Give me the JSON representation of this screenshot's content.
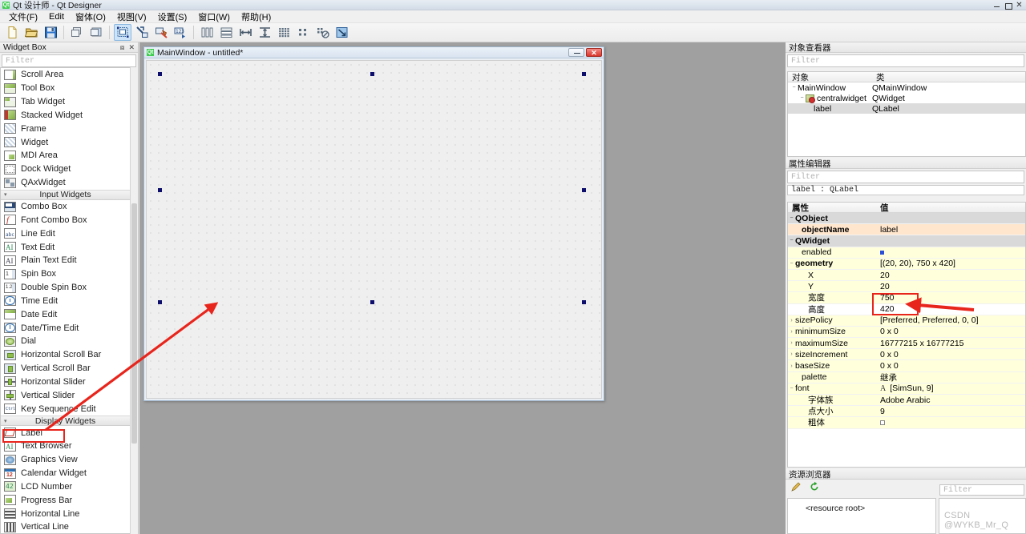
{
  "window": {
    "title": "Qt 设计师 - Qt Designer",
    "logo": "qt-logo",
    "buttons": {
      "minimize": "minimize-icon",
      "maximize": "maximize-icon",
      "close": "close-icon"
    }
  },
  "menubar": {
    "items": [
      {
        "label": "文件(F)"
      },
      {
        "label": "Edit"
      },
      {
        "label": "窗体(O)"
      },
      {
        "label": "视图(V)"
      },
      {
        "label": "设置(S)"
      },
      {
        "label": "窗口(W)"
      },
      {
        "label": "帮助(H)"
      }
    ]
  },
  "toolbar": {
    "items": [
      {
        "name": "new-form-icon",
        "active": false
      },
      {
        "name": "open-icon",
        "active": false
      },
      {
        "name": "save-icon",
        "active": false
      },
      {
        "name": "separator",
        "active": false
      },
      {
        "name": "undo-icon",
        "active": false
      },
      {
        "name": "redo-icon",
        "active": false
      },
      {
        "name": "separator",
        "active": false
      },
      {
        "name": "edit-widgets-icon",
        "active": true
      },
      {
        "name": "edit-signals-slots-icon",
        "active": false
      },
      {
        "name": "edit-buddies-icon",
        "active": false
      },
      {
        "name": "edit-tab-order-icon",
        "active": false
      },
      {
        "name": "separator",
        "active": false
      },
      {
        "name": "layout-horizontally-icon",
        "active": false
      },
      {
        "name": "layout-vertically-icon",
        "active": false
      },
      {
        "name": "layout-splitter-horizontal-icon",
        "active": false
      },
      {
        "name": "layout-splitter-vertical-icon",
        "active": false
      },
      {
        "name": "layout-grid-icon",
        "active": false
      },
      {
        "name": "layout-form-icon",
        "active": false
      },
      {
        "name": "break-layout-icon",
        "active": false
      },
      {
        "name": "adjust-size-icon",
        "active": false
      }
    ]
  },
  "widget_box": {
    "title": "Widget Box",
    "float_icon": "undock-icon",
    "close_icon": "close-icon",
    "filter_placeholder": "Filter",
    "items": [
      {
        "label": "Scroll Area",
        "icon": "scroll-area-icon",
        "type": "item"
      },
      {
        "label": "Tool Box",
        "icon": "tool-box-icon",
        "type": "item"
      },
      {
        "label": "Tab Widget",
        "icon": "tab-widget-icon",
        "type": "item"
      },
      {
        "label": "Stacked Widget",
        "icon": "stacked-widget-icon",
        "type": "item"
      },
      {
        "label": "Frame",
        "icon": "frame-icon",
        "type": "item"
      },
      {
        "label": "Widget",
        "icon": "widget-icon",
        "type": "item"
      },
      {
        "label": "MDI Area",
        "icon": "mdi-area-icon",
        "type": "item"
      },
      {
        "label": "Dock Widget",
        "icon": "dock-widget-icon",
        "type": "item"
      },
      {
        "label": "QAxWidget",
        "icon": "qax-widget-icon",
        "type": "item"
      },
      {
        "label": "Input Widgets",
        "icon": "",
        "type": "category"
      },
      {
        "label": "Combo Box",
        "icon": "combo-box-icon",
        "type": "item"
      },
      {
        "label": "Font Combo Box",
        "icon": "font-combo-box-icon",
        "type": "item"
      },
      {
        "label": "Line Edit",
        "icon": "line-edit-icon",
        "type": "item"
      },
      {
        "label": "Text Edit",
        "icon": "text-edit-icon",
        "type": "item"
      },
      {
        "label": "Plain Text Edit",
        "icon": "plain-text-edit-icon",
        "type": "item"
      },
      {
        "label": "Spin Box",
        "icon": "spin-box-icon",
        "type": "item"
      },
      {
        "label": "Double Spin Box",
        "icon": "double-spin-box-icon",
        "type": "item"
      },
      {
        "label": "Time Edit",
        "icon": "time-edit-icon",
        "type": "item"
      },
      {
        "label": "Date Edit",
        "icon": "date-edit-icon",
        "type": "item"
      },
      {
        "label": "Date/Time Edit",
        "icon": "date-time-edit-icon",
        "type": "item"
      },
      {
        "label": "Dial",
        "icon": "dial-icon",
        "type": "item"
      },
      {
        "label": "Horizontal Scroll Bar",
        "icon": "horizontal-scroll-bar-icon",
        "type": "item"
      },
      {
        "label": "Vertical Scroll Bar",
        "icon": "vertical-scroll-bar-icon",
        "type": "item"
      },
      {
        "label": "Horizontal Slider",
        "icon": "horizontal-slider-icon",
        "type": "item"
      },
      {
        "label": "Vertical Slider",
        "icon": "vertical-slider-icon",
        "type": "item"
      },
      {
        "label": "Key Sequence Edit",
        "icon": "key-sequence-edit-icon",
        "type": "item"
      },
      {
        "label": "Display Widgets",
        "icon": "",
        "type": "category"
      },
      {
        "label": "Label",
        "icon": "label-icon",
        "type": "item",
        "highlighted": true
      },
      {
        "label": "Text Browser",
        "icon": "text-browser-icon",
        "type": "item"
      },
      {
        "label": "Graphics View",
        "icon": "graphics-view-icon",
        "type": "item"
      },
      {
        "label": "Calendar Widget",
        "icon": "calendar-widget-icon",
        "type": "item"
      },
      {
        "label": "LCD Number",
        "icon": "lcd-number-icon",
        "type": "item"
      },
      {
        "label": "Progress Bar",
        "icon": "progress-bar-icon",
        "type": "item"
      },
      {
        "label": "Horizontal Line",
        "icon": "horizontal-line-icon",
        "type": "item"
      },
      {
        "label": "Vertical Line",
        "icon": "vertical-line-icon",
        "type": "item"
      }
    ]
  },
  "form": {
    "title": "MainWindow - untitled*",
    "logo": "qt-logo",
    "minimize_label": "minimize-icon",
    "close_label": "×",
    "selection_handles": 8
  },
  "object_inspector": {
    "title": "对象查看器",
    "filter_placeholder": "Filter",
    "columns": [
      "对象",
      "类"
    ],
    "rows": [
      {
        "object": "MainWindow",
        "class": "QMainWindow",
        "depth": 0,
        "expander": "−",
        "selected": false,
        "icon": ""
      },
      {
        "object": "centralwidget",
        "class": "QWidget",
        "depth": 1,
        "expander": "−",
        "selected": false,
        "icon": "central-widget-icon"
      },
      {
        "object": "label",
        "class": "QLabel",
        "depth": 2,
        "expander": "",
        "selected": true,
        "icon": ""
      }
    ]
  },
  "property_editor": {
    "title": "属性编辑器",
    "filter_placeholder": "Filter",
    "selected_object": "label : QLabel",
    "columns": [
      "属性",
      "值"
    ],
    "rows": [
      {
        "name": "QObject",
        "value": "",
        "style": "group",
        "indent": 0,
        "expander": "−"
      },
      {
        "name": "objectName",
        "value": "label",
        "style": "tan",
        "indent": 1,
        "expander": "",
        "bold": true
      },
      {
        "name": "QWidget",
        "value": "",
        "style": "group",
        "indent": 0,
        "expander": "−"
      },
      {
        "name": "enabled",
        "value": "",
        "style": "yellow",
        "indent": 1,
        "expander": "",
        "widget": "checkbox-checked"
      },
      {
        "name": "geometry",
        "value": "[(20, 20), 750 x 420]",
        "style": "yellow",
        "indent": 0,
        "expander": "−",
        "bold": true
      },
      {
        "name": "X",
        "value": "20",
        "style": "yellow",
        "indent": 2,
        "expander": ""
      },
      {
        "name": "Y",
        "value": "20",
        "style": "yellow",
        "indent": 2,
        "expander": ""
      },
      {
        "name": "宽度",
        "value": "750",
        "style": "yellow",
        "indent": 2,
        "expander": "",
        "highlighted": true
      },
      {
        "name": "高度",
        "value": "420",
        "style": "white",
        "indent": 2,
        "expander": "",
        "highlighted": true
      },
      {
        "name": "sizePolicy",
        "value": "[Preferred, Preferred, 0, 0]",
        "style": "yellow",
        "indent": 0,
        "expander": "›"
      },
      {
        "name": "minimumSize",
        "value": "0 x 0",
        "style": "yellow",
        "indent": 0,
        "expander": "›"
      },
      {
        "name": "maximumSize",
        "value": "16777215 x 16777215",
        "style": "yellow",
        "indent": 0,
        "expander": "›"
      },
      {
        "name": "sizeIncrement",
        "value": "0 x 0",
        "style": "yellow",
        "indent": 0,
        "expander": "›"
      },
      {
        "name": "baseSize",
        "value": "0 x 0",
        "style": "yellow",
        "indent": 0,
        "expander": "›"
      },
      {
        "name": "palette",
        "value": "继承",
        "style": "yellow",
        "indent": 1,
        "expander": ""
      },
      {
        "name": "font",
        "value": "[SimSun, 9]",
        "style": "yellow",
        "indent": 0,
        "expander": "−",
        "widget": "font-glyph"
      },
      {
        "name": "字体族",
        "value": "Adobe Arabic",
        "style": "yellow",
        "indent": 2,
        "expander": ""
      },
      {
        "name": "点大小",
        "value": "9",
        "style": "yellow",
        "indent": 2,
        "expander": ""
      },
      {
        "name": "粗体",
        "value": "",
        "style": "yellow",
        "indent": 2,
        "expander": "",
        "widget": "checkbox-unchecked"
      }
    ]
  },
  "resource_browser": {
    "title": "资源浏览器",
    "edit_icon": "pencil-icon",
    "reload_icon": "reload-icon",
    "filter_placeholder": "Filter",
    "tree_root": "<resource root>",
    "watermark": "CSDN @WYKB_Mr_Q"
  },
  "annotations": {
    "color": "#e8251c",
    "arrow_canvas": {
      "from_label": "Label",
      "to": "form-canvas"
    },
    "arrow_property": {
      "to": "geometry-width-height"
    },
    "boxes": [
      "label-widget-item",
      "geometry-size-fields"
    ]
  },
  "colors": {
    "accent": "#e8251c",
    "selection_handle": "#0d0d6b",
    "property_yellow": "#ffffdc",
    "property_tan": "#ffe6cc",
    "qt_green": "#41cd52"
  }
}
